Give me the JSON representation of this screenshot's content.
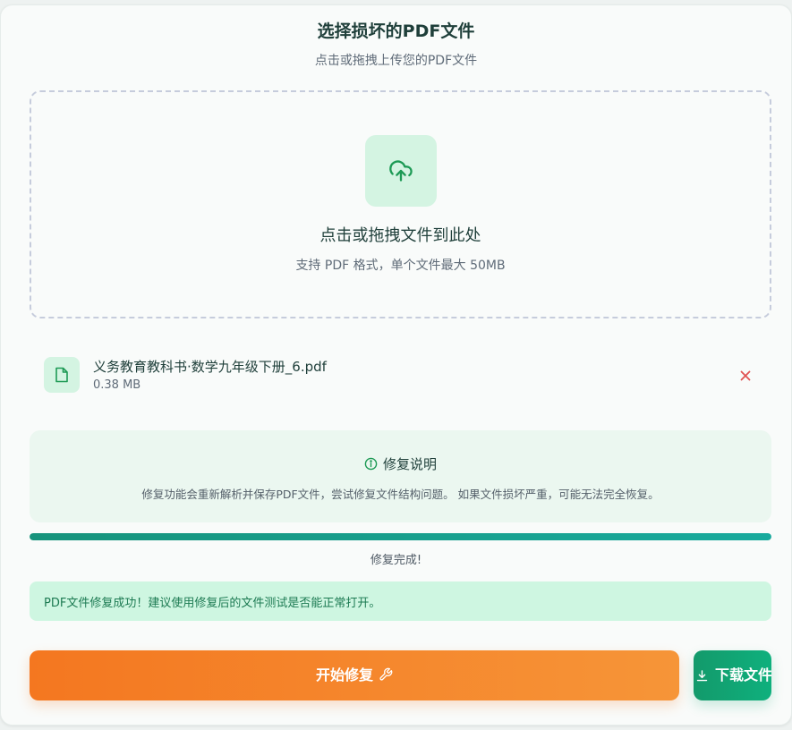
{
  "header": {
    "title": "选择损坏的PDF文件",
    "subtitle": "点击或拖拽上传您的PDF文件"
  },
  "dropzone": {
    "icon": "cloud-upload-icon",
    "title": "点击或拖拽文件到此处",
    "hint": "支持 PDF 格式，单个文件最大 50MB"
  },
  "file": {
    "icon": "file-icon",
    "name": "义务教育教科书·数学九年级下册_6.pdf",
    "size": "0.38 MB",
    "remove_icon": "close-icon"
  },
  "info": {
    "icon": "info-icon",
    "title": "修复说明",
    "body": "修复功能会重新解析并保存PDF文件，尝试修复文件结构问题。 如果文件损坏严重，可能无法完全恢复。"
  },
  "progress": {
    "percent": 100,
    "status": "修复完成!"
  },
  "result": {
    "message": "PDF文件修复成功！建议使用修复后的文件测试是否能正常打开。"
  },
  "actions": {
    "start_label": "开始修复",
    "start_icon": "wrench-icon",
    "download_label": "下载文件",
    "download_icon": "download-icon"
  },
  "colors": {
    "accent_green": "#17937c",
    "orange": "#f47720",
    "danger": "#e05353"
  }
}
